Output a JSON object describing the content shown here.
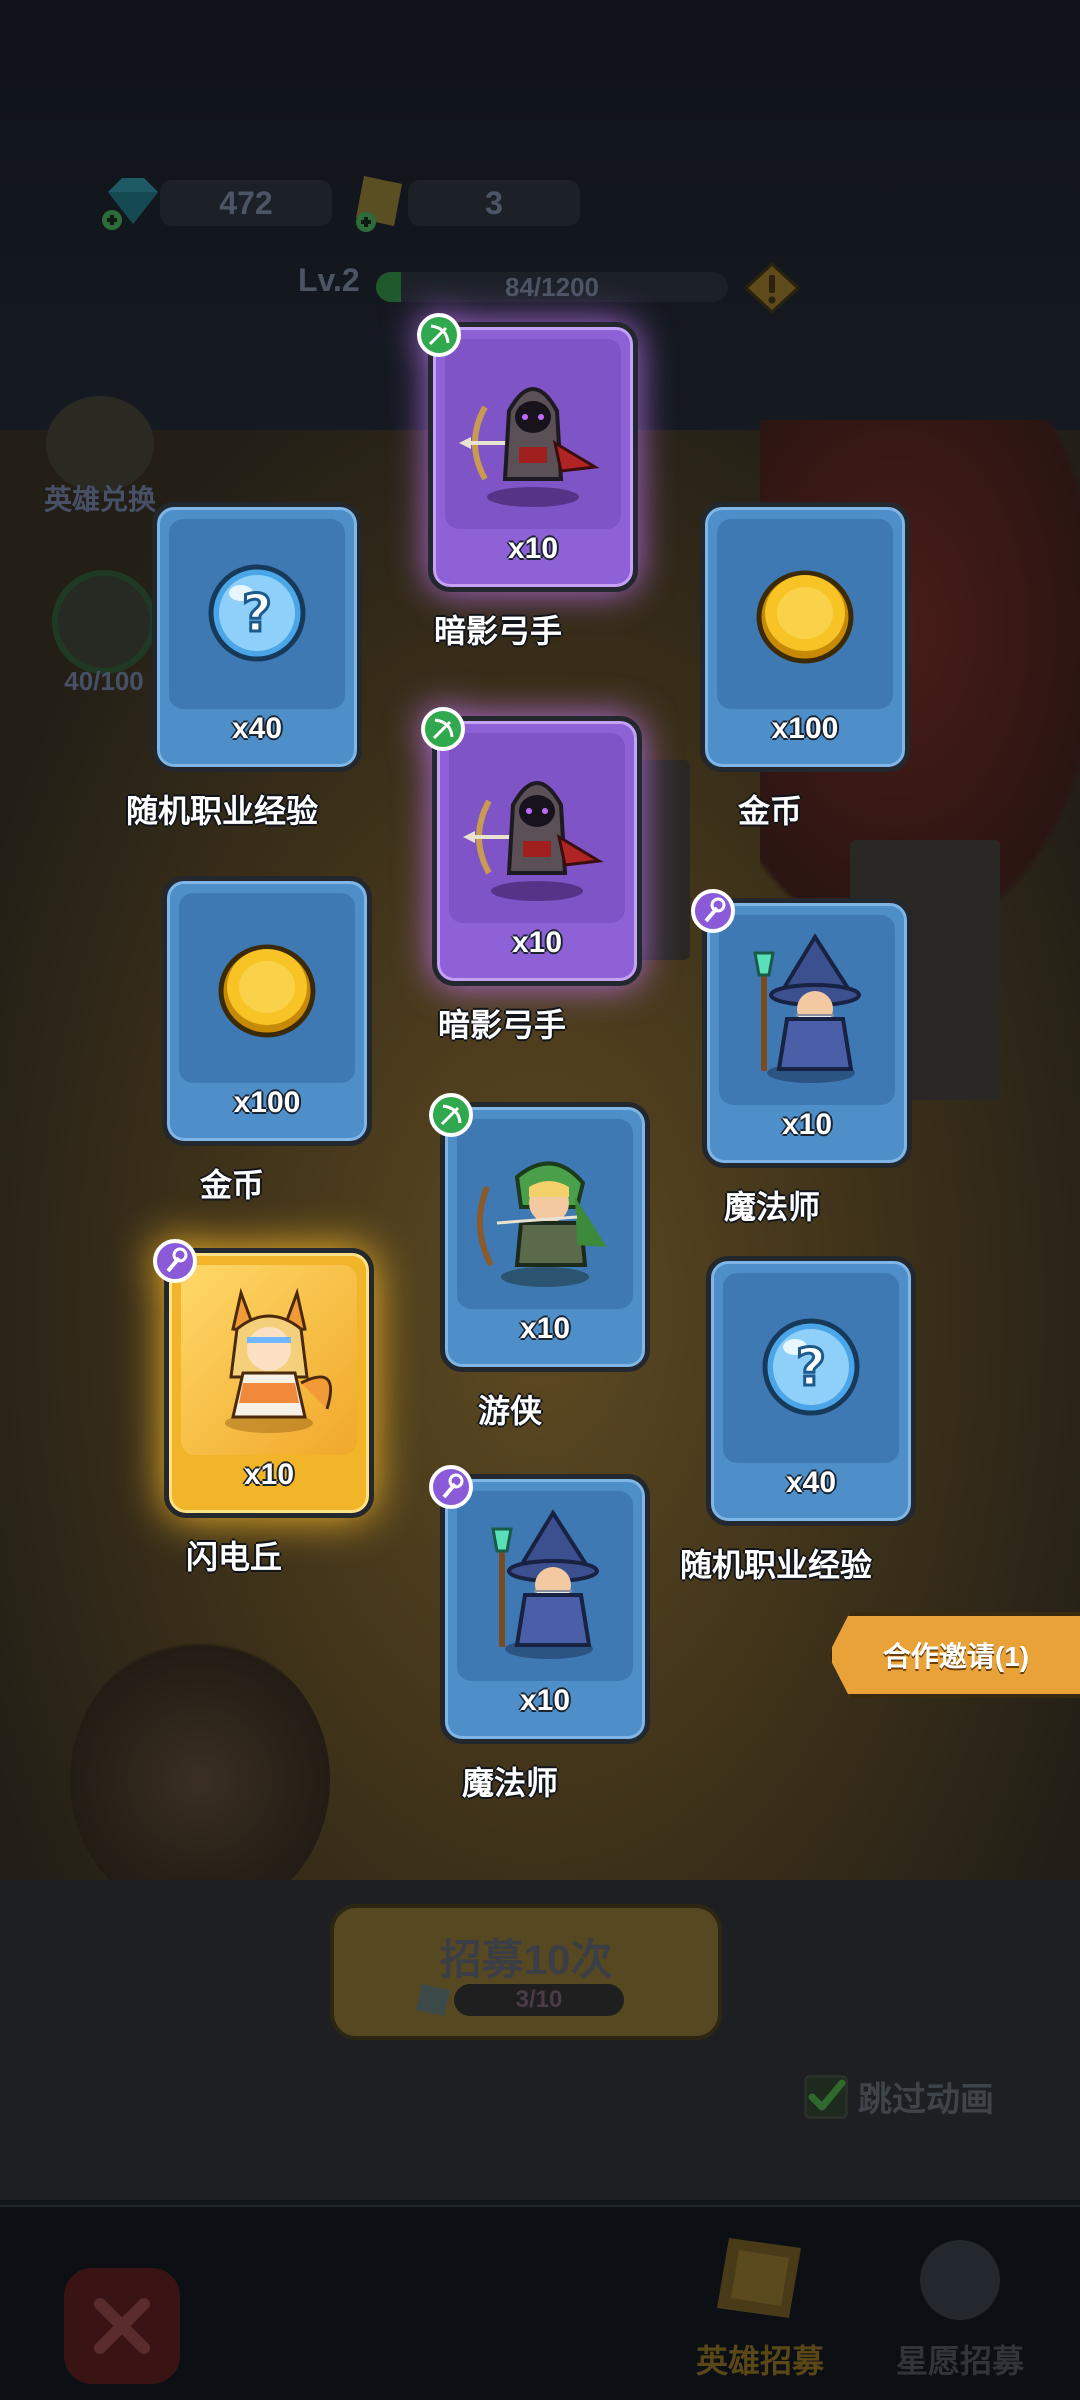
{
  "hud": {
    "gems": "472",
    "tickets": "3",
    "level": "Lv.2",
    "exp_text": "84/1200",
    "exp_fraction": 0.07
  },
  "side": {
    "hero_exchange": "英雄兑换",
    "star_progress": "40/100"
  },
  "cards": [
    {
      "name": "暗影弓手",
      "qty": "x10",
      "rarity": "purple",
      "art": "shadow-archer",
      "badge": "bow-class"
    },
    {
      "name": "随机职业经验",
      "qty": "x40",
      "rarity": "blue",
      "art": "question-orb",
      "badge": ""
    },
    {
      "name": "金币",
      "qty": "x100",
      "rarity": "blue",
      "art": "gold-coin",
      "badge": ""
    },
    {
      "name": "暗影弓手",
      "qty": "x10",
      "rarity": "purple",
      "art": "shadow-archer",
      "badge": "bow-class"
    },
    {
      "name": "金币",
      "qty": "x100",
      "rarity": "blue",
      "art": "gold-coin",
      "badge": ""
    },
    {
      "name": "魔法师",
      "qty": "x10",
      "rarity": "blue",
      "art": "wizard",
      "badge": "staff-class"
    },
    {
      "name": "游侠",
      "qty": "x10",
      "rarity": "blue",
      "art": "ranger",
      "badge": "bow-class"
    },
    {
      "name": "闪电丘",
      "qty": "x10",
      "rarity": "gold",
      "art": "fox-mage",
      "badge": "staff-class"
    },
    {
      "name": "随机职业经验",
      "qty": "x40",
      "rarity": "blue",
      "art": "question-orb",
      "badge": ""
    },
    {
      "name": "魔法师",
      "qty": "x10",
      "rarity": "blue",
      "art": "wizard",
      "badge": "staff-class"
    }
  ],
  "coop_invite": "合作邀请(1)",
  "recruit": {
    "title": "招募10次",
    "count": "3/10"
  },
  "skip_animation": "跳过动画",
  "nav": {
    "hero_recruit": "英雄招募",
    "wish_recruit": "星愿招募"
  },
  "colors": {
    "purple_card": "#8e62d6",
    "blue_card": "#4f8fc9",
    "gold_card": "#f2b52a",
    "coop_tab": "#e8a238"
  }
}
